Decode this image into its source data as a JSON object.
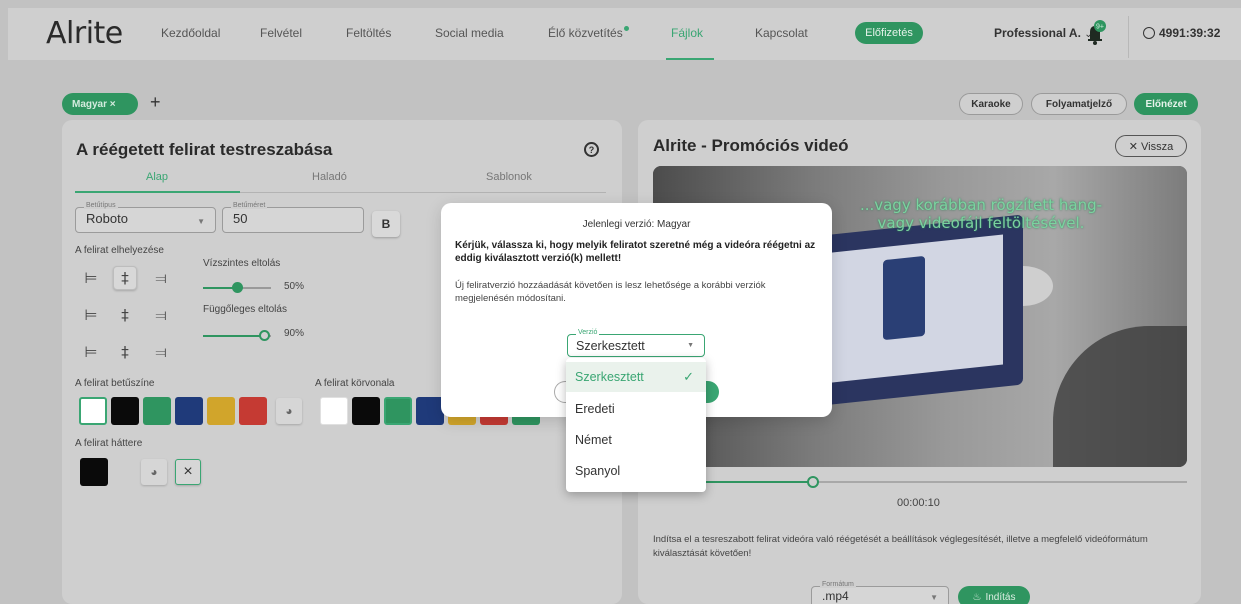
{
  "nav": {
    "logo": "Alrite",
    "links": [
      "Kezdőoldal",
      "Felvétel",
      "Feltöltés",
      "Social media",
      "Élő közvetítés",
      "Fájlok",
      "Kapcsolat"
    ],
    "active_link": "Fájlok",
    "subscribe_label": "Előfizetés",
    "user": "Professional A.",
    "user_caret": "⌄",
    "notification_badge": "9+",
    "timer": "4991:39:32",
    "accent_color": "#3aa673"
  },
  "lang_bar": {
    "active_lang": "Magyar ×",
    "add_label": "+",
    "right_buttons": [
      "Karaoke",
      "Folyamatjelző",
      "Előnézet"
    ]
  },
  "left_panel": {
    "title": "A réégetett felirat testreszabása",
    "help": "?",
    "tabs": [
      "Alap",
      "Haladó",
      "Sablonok"
    ],
    "font_field": {
      "label": "Betűtípus",
      "value": "Roboto"
    },
    "size_field": {
      "label": "Betűméret",
      "value": "50"
    },
    "bold_label": "B",
    "placement_label": "A felirat elhelyezése",
    "horizontal_label": "Vízszintes eltolás",
    "horizontal_value": "50%",
    "horizontal_fraction": 0.5,
    "vertical_label": "Függőleges eltolás",
    "vertical_value": "90%",
    "vertical_fraction": 0.9,
    "font_color_label": "A felirat betűszíne",
    "outline_color_label": "A felirat körvonala",
    "background_label": "A felirat háttere",
    "font_colors": [
      "#ffffff",
      "#0a0a0a",
      "#2f9560",
      "#1f3a7a",
      "#d1a52b",
      "#c53a33"
    ],
    "outline_colors": [
      "#ffffff",
      "#0a0a0a",
      "#2f9560",
      "#1f3a7a",
      "#d1a52b",
      "#c53a33",
      "#2f9560"
    ],
    "background_colors": [
      "#0a0a0a",
      "#cfcfcf"
    ],
    "clear_label": "×"
  },
  "right_panel": {
    "title": "Alrite - Promóciós videó",
    "back_label": "✕ Vissza",
    "video_subtitle": "...vagy korábban rögzített hang-\nvagy videofájl feltöltésével.",
    "progress_fraction": 0.3,
    "time": "00:00:10",
    "description": "Indítsa el a tesreszabott felirat videóra való réégetését a beállítások véglegesítését, illetve a megfelelő videóformátum kiválasztását követően!",
    "format_label": "Formátum",
    "format_value": ".mp4",
    "start_label": "Indítás"
  },
  "modal": {
    "title": "Jelenlegi verzió: Magyar",
    "question": "Kérjük, válassza ki, hogy melyik feliratot szeretné még a videóra réégetni az eddig kiválasztott verzió(k) mellett!",
    "note": "Új feliratverzió hozzáadását követően is lesz lehetősége a korábbi verziók megjelenésén módosítani.",
    "select_label": "Verzió",
    "select_value": "Szerkesztett",
    "options": [
      "Szerkesztett",
      "Eredeti",
      "Német",
      "Spanyol"
    ],
    "selected_option": "Szerkesztett"
  }
}
